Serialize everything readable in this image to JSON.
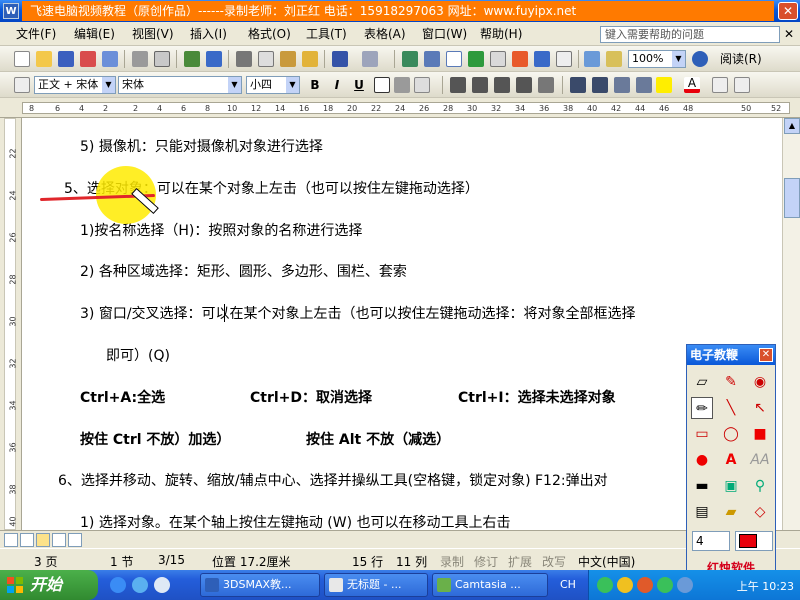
{
  "title_bar": {
    "banner": "飞速电脑视频教程（原创作品）------录制老师：刘正红    电话：15918297063   网址：www.fuyipx.net",
    "close": "✕"
  },
  "menu": [
    "文件(F)",
    "编辑(E)",
    "视图(V)",
    "插入(I)",
    "格式(O)",
    "工具(T)",
    "表格(A)",
    "窗口(W)",
    "帮助(H)"
  ],
  "help_search_placeholder": "键入需要帮助的问题",
  "toolbar1": {
    "zoom": "100%",
    "reading": "阅读(R)"
  },
  "toolbar2": {
    "style": "正文 + 宋体",
    "font": "宋体",
    "size": "小四",
    "bold": "B",
    "italic": "I",
    "underline": "U"
  },
  "ruler": {
    "marks": [
      "8",
      "6",
      "4",
      "2",
      "2",
      "4",
      "6",
      "8",
      "10",
      "12",
      "14",
      "16",
      "18",
      "20",
      "22",
      "24",
      "26",
      "28",
      "30",
      "32",
      "34",
      "36",
      "38",
      "40",
      "42",
      "44",
      "46",
      "48",
      "50",
      "52"
    ]
  },
  "vruler": {
    "marks": [
      "22",
      "24",
      "26",
      "28",
      "30",
      "32",
      "34",
      "36",
      "38",
      "40"
    ]
  },
  "doc_lines": [
    {
      "text": "5) 摄像机：只能对摄像机对象进行选择",
      "bold": false
    },
    {
      "text": "5、选择对象：可以在某个对象上左击（也可以按住左键拖动选择）",
      "bold": false
    },
    {
      "text": "1)按名称选择（H)：按照对象的名称进行选择",
      "bold": false
    },
    {
      "text": "2) 各种区域选择：矩形、圆形、多边形、围栏、套索",
      "bold": false
    },
    {
      "text": "3) 窗口/交叉选择：可以在某个对象上左击（也可以按住左键拖动选择：将对象全部框选择",
      "bold": false
    },
    {
      "text": "即可）(Q)",
      "bold": false
    },
    {
      "text": "Ctrl+A:全选",
      "bold": true
    },
    {
      "text": "Ctrl+D：取消选择",
      "bold": true
    },
    {
      "text": "Ctrl+I：选择未选择对象",
      "bold": true
    },
    {
      "text": "按住 Ctrl 不放）加选）",
      "bold": true
    },
    {
      "text": "按住 Alt 不放（减选）",
      "bold": true
    },
    {
      "text": "6、选择并移动、旋转、缩放/辅点中心、选择并操纵工具(空格键，锁定对象) F12:弹出对",
      "bold": false
    },
    {
      "text": "1) 选择对象。在某个轴上按住左键拖动 (W) 也可以在移动工具上右击",
      "bold": false
    }
  ],
  "status": {
    "page": "3 页",
    "section": "1 节",
    "pages": "3/15",
    "position": "位置 17.2厘米",
    "row": "15 行",
    "col": "11 列",
    "rec": "录制",
    "trk": "修订",
    "ext": "扩展",
    "ovr": "改写",
    "lang": "中文(中国)"
  },
  "palette": {
    "title": "电子教鞭",
    "close": "✕",
    "size": "4",
    "brand": "红烛软件",
    "color": "#e8000b"
  },
  "taskbar": {
    "start": "开始",
    "tasks": [
      "3DSMAX教...",
      "无标题 - ...",
      "Camtasia ..."
    ],
    "lang": "CH",
    "clock": "上午 10:23"
  }
}
